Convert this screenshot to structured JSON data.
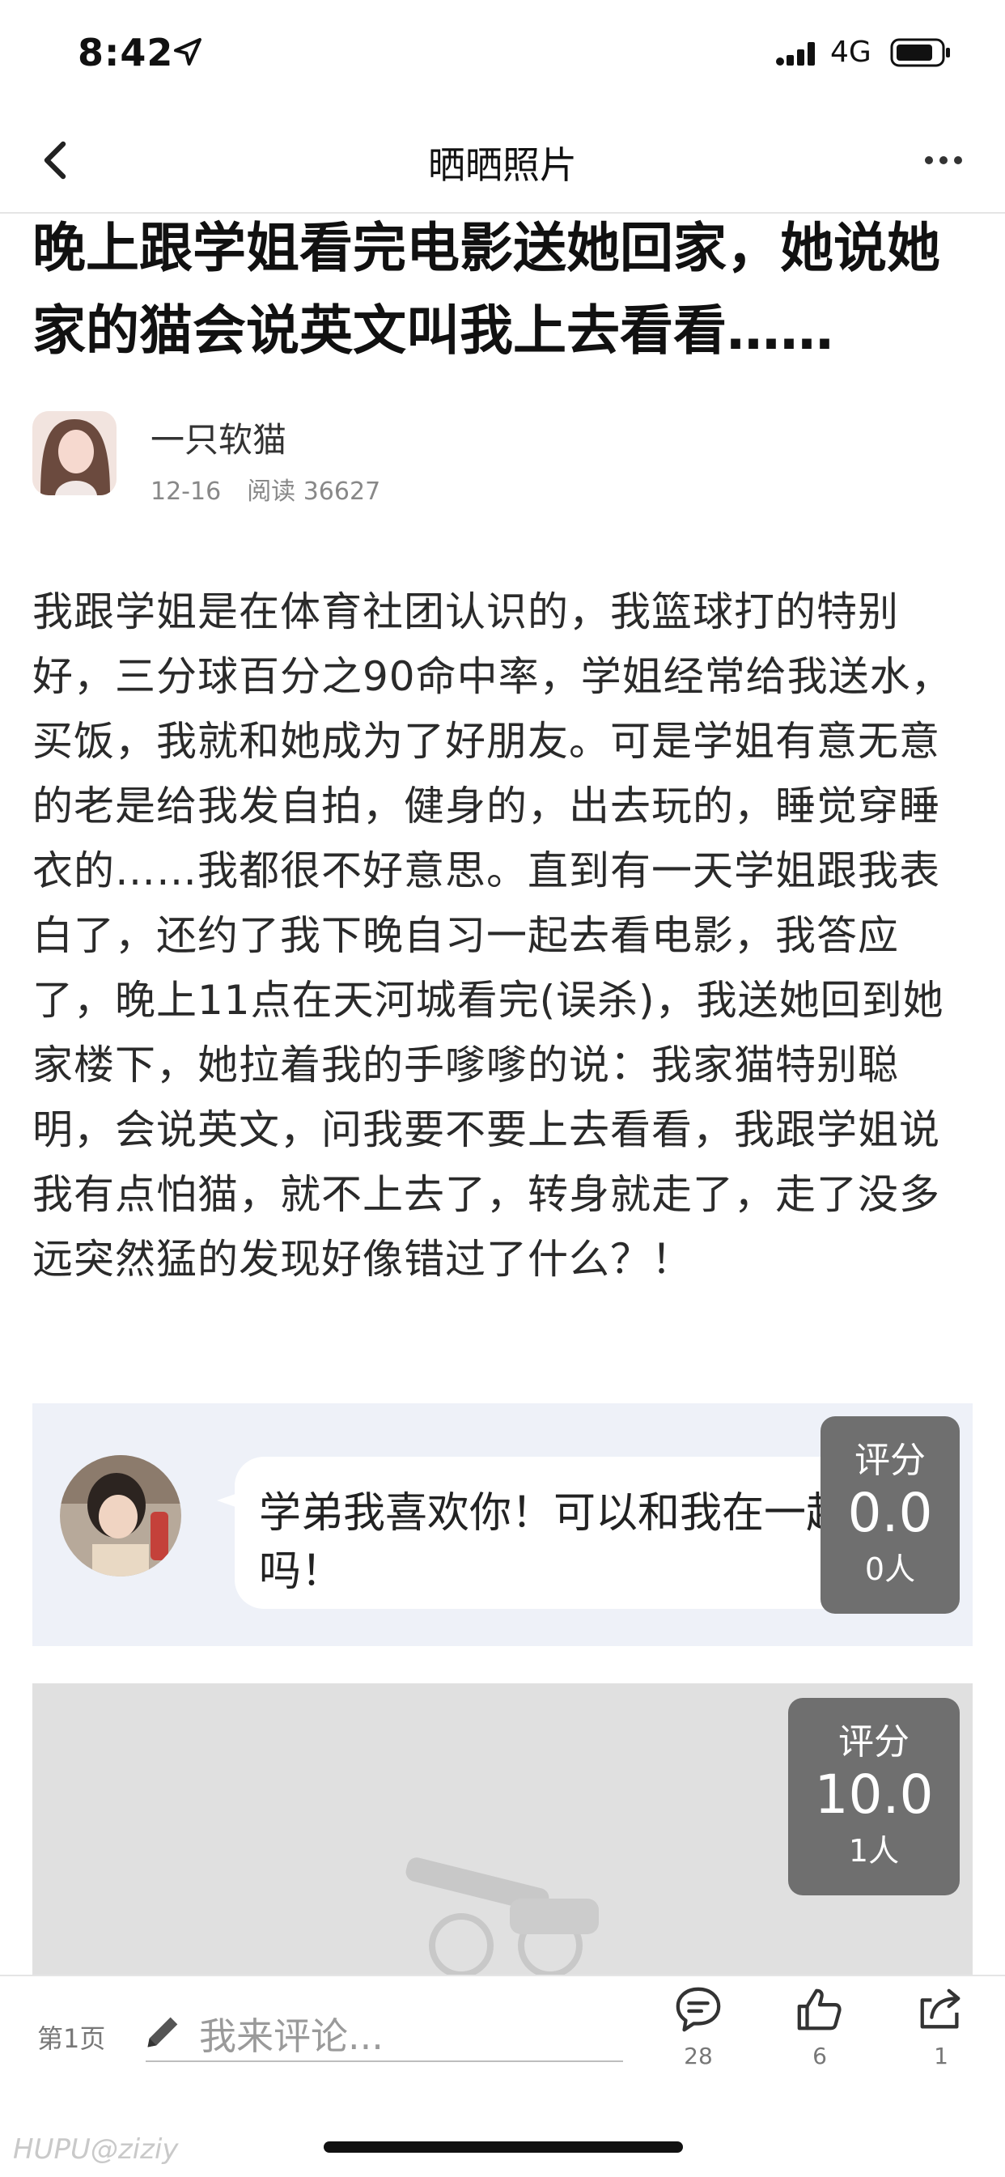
{
  "status_bar": {
    "time": "8:42",
    "network": "4G"
  },
  "nav": {
    "title": "晒晒照片"
  },
  "post": {
    "title": "晚上跟学姐看完电影送她回家，她说她家的猫会说英文叫我上去看看……",
    "author": "一只软猫",
    "date": "12-16",
    "reads": "阅读 36627",
    "body": "我跟学姐是在体育社团认识的，我篮球打的特别好，三分球百分之90命中率，学姐经常给我送水，买饭，我就和她成为了好朋友。可是学姐有意无意的老是给我发自拍，健身的，出去玩的，睡觉穿睡衣的……我都很不好意思。直到有一天学姐跟我表白了，还约了我下晚自习一起去看电影，我答应了，晚上11点在天河城看完(误杀)，我送她回到她家楼下，她拉着我的手嗲嗲的说：我家猫特别聪明，会说英文，问我要不要上去看看，我跟学姐说我有点怕猫，就不上去了，转身就走了，走了没多远突然猛的发现好像错过了什么？！"
  },
  "images": [
    {
      "bubble_text": "学弟我喜欢你！可以和我在一起吗！",
      "score_label": "评分",
      "score_value": "0.0",
      "score_count": "0人"
    },
    {
      "score_label": "评分",
      "score_value": "10.0",
      "score_count": "1人"
    }
  ],
  "bottom_bar": {
    "page_label": "第1页",
    "comment_placeholder": "我来评论...",
    "comments_count": "28",
    "likes_count": "6",
    "shares_count": "1"
  },
  "watermark": {
    "brand": "HUPU",
    "user": "@ziziy"
  }
}
